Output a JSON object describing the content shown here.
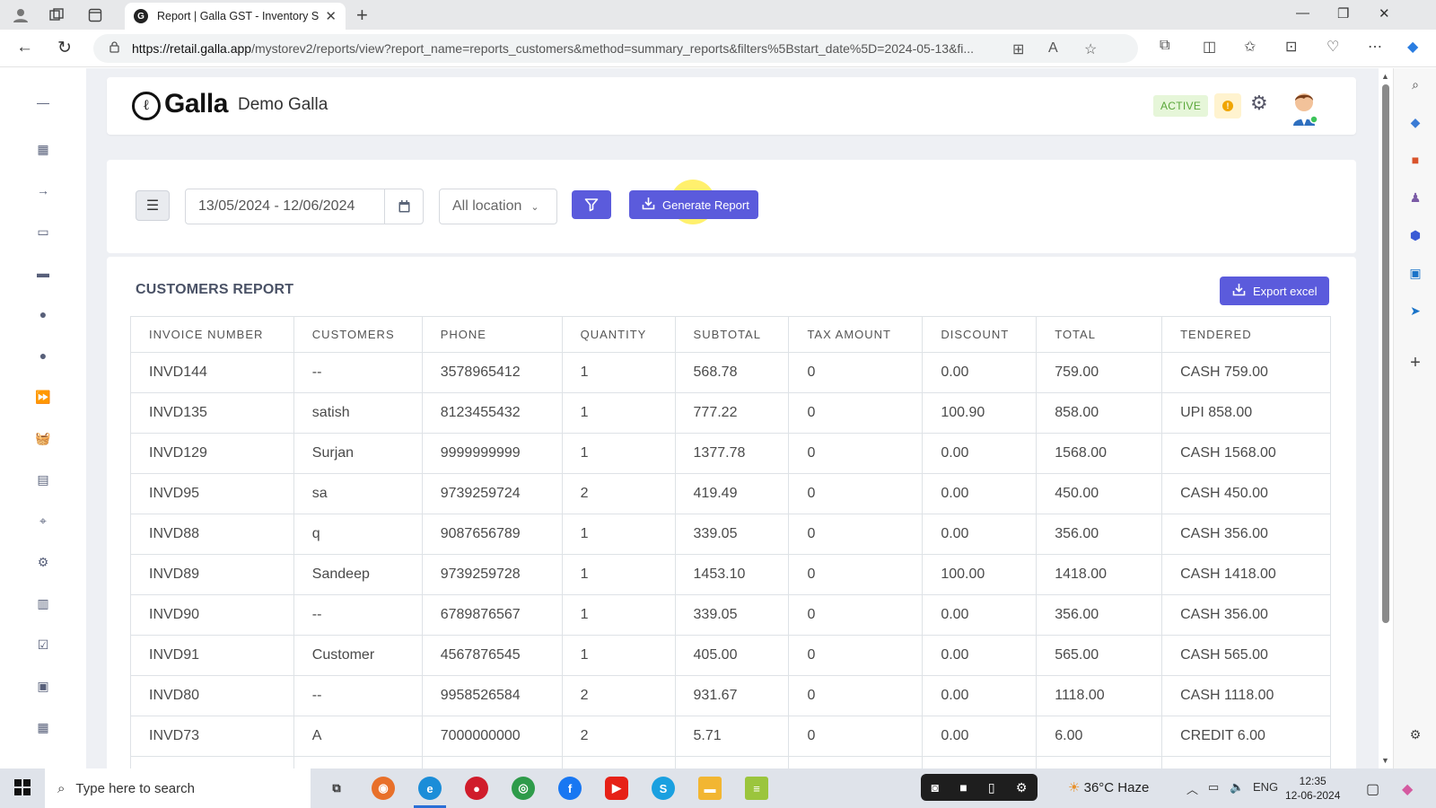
{
  "browser": {
    "tab_title": "Report | Galla GST - Inventory Software",
    "url_host": "https://retail.galla.app",
    "url_path": "/mystorev2/reports/view?report_name=reports_customers&method=summary_reports&filters%5Bstart_date%5D=2024-05-13&fi..."
  },
  "header": {
    "logo_text": "Galla",
    "store_name": "Demo Galla",
    "status_badge": "ACTIVE",
    "notification_count": "!"
  },
  "filters": {
    "date_range": "13/05/2024 - 12/06/2024",
    "location": "All location",
    "generate_label": "Generate Report"
  },
  "report": {
    "title": "CUSTOMERS REPORT",
    "export_label": "Export excel",
    "columns": [
      "INVOICE NUMBER",
      "CUSTOMERS",
      "PHONE",
      "QUANTITY",
      "SUBTOTAL",
      "TAX AMOUNT",
      "DISCOUNT",
      "TOTAL",
      "TENDERED"
    ],
    "rows": [
      [
        "INVD144",
        "--",
        "3578965412",
        "1",
        "568.78",
        "0",
        "0.00",
        "759.00",
        "CASH 759.00"
      ],
      [
        "INVD135",
        "satish",
        "8123455432",
        "1",
        "777.22",
        "0",
        "100.90",
        "858.00",
        "UPI 858.00"
      ],
      [
        "INVD129",
        "Surjan",
        "9999999999",
        "1",
        "1377.78",
        "0",
        "0.00",
        "1568.00",
        "CASH 1568.00"
      ],
      [
        "INVD95",
        "sa",
        "9739259724",
        "2",
        "419.49",
        "0",
        "0.00",
        "450.00",
        "CASH 450.00"
      ],
      [
        "INVD88",
        "q",
        "9087656789",
        "1",
        "339.05",
        "0",
        "0.00",
        "356.00",
        "CASH 356.00"
      ],
      [
        "INVD89",
        "Sandeep",
        "9739259728",
        "1",
        "1453.10",
        "0",
        "100.00",
        "1418.00",
        "CASH 1418.00"
      ],
      [
        "INVD90",
        "--",
        "6789876567",
        "1",
        "339.05",
        "0",
        "0.00",
        "356.00",
        "CASH 356.00"
      ],
      [
        "INVD91",
        "Customer",
        "4567876545",
        "1",
        "405.00",
        "0",
        "0.00",
        "565.00",
        "CASH 565.00"
      ],
      [
        "INVD80",
        "--",
        "9958526584",
        "2",
        "931.67",
        "0",
        "0.00",
        "1118.00",
        "CASH 1118.00"
      ],
      [
        "INVD73",
        "A",
        "7000000000",
        "2",
        "5.71",
        "0",
        "0.00",
        "6.00",
        "CREDIT 6.00"
      ]
    ]
  },
  "taskbar": {
    "search_placeholder": "Type here to search",
    "weather": "36°C  Haze",
    "lang": "ENG",
    "time": "12:35",
    "date": "12-06-2024"
  },
  "colors": {
    "accent": "#5b5bdc",
    "active_badge_bg": "#e6f6d9",
    "active_badge_text": "#5aa73a",
    "page_bg": "#eef0f4"
  }
}
